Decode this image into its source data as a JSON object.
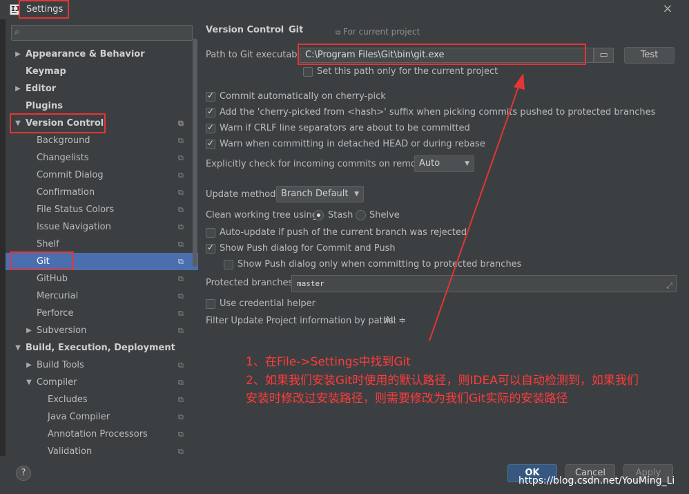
{
  "window": {
    "title": "Settings",
    "app_icon": "IJ",
    "close_icon": "close-icon"
  },
  "sidebar": {
    "search_placeholder": "",
    "search_icon": "search-icon",
    "items": [
      {
        "label": "Appearance & Behavior",
        "level": 0,
        "arrow": "▶",
        "bold": true
      },
      {
        "label": "Keymap",
        "level": 0,
        "arrow": "",
        "bold": true
      },
      {
        "label": "Editor",
        "level": 0,
        "arrow": "▶",
        "bold": true
      },
      {
        "label": "Plugins",
        "level": 0,
        "arrow": "",
        "bold": true
      },
      {
        "label": "Version Control",
        "level": 0,
        "arrow": "▼",
        "bold": true
      },
      {
        "label": "Background",
        "level": 1
      },
      {
        "label": "Changelists",
        "level": 1
      },
      {
        "label": "Commit Dialog",
        "level": 1
      },
      {
        "label": "Confirmation",
        "level": 1
      },
      {
        "label": "File Status Colors",
        "level": 1
      },
      {
        "label": "Issue Navigation",
        "level": 1
      },
      {
        "label": "Shelf",
        "level": 1
      },
      {
        "label": "Git",
        "level": 1,
        "selected": true
      },
      {
        "label": "GitHub",
        "level": 1
      },
      {
        "label": "Mercurial",
        "level": 1
      },
      {
        "label": "Perforce",
        "level": 1
      },
      {
        "label": "Subversion",
        "level": 1,
        "arrow": "▶"
      },
      {
        "label": "Build, Execution, Deployment",
        "level": 0,
        "arrow": "▼",
        "bold": true
      },
      {
        "label": "Build Tools",
        "level": 1,
        "arrow": "▶"
      },
      {
        "label": "Compiler",
        "level": 1,
        "arrow": "▼"
      },
      {
        "label": "Excludes",
        "level": 2
      },
      {
        "label": "Java Compiler",
        "level": 2
      },
      {
        "label": "Annotation Processors",
        "level": 2
      },
      {
        "label": "Validation",
        "level": 2
      }
    ],
    "project_icon": "project-settings-icon"
  },
  "content": {
    "breadcrumb_root": "Version Control",
    "breadcrumb_sep": "›",
    "breadcrumb_leaf": "Git",
    "for_current_project": "For current project",
    "path_label": "Path to Git executable:",
    "path_value": "C:\\Program Files\\Git\\bin\\git.exe",
    "folder_icon": "folder-icon",
    "test_button": "Test",
    "set_path_only": "Set this path only for the current project",
    "commit_cherry_pick": "Commit automatically on cherry-pick",
    "cherry_suffix": "Add the 'cherry-picked from <hash>' suffix when picking commits pushed to protected branches",
    "warn_crlf": "Warn if CRLF line separators are about to be committed",
    "warn_detached": "Warn when committing in detached HEAD or during rebase",
    "incoming_label": "Explicitly check for incoming commits on remotes:",
    "incoming_value": "Auto",
    "update_method_label": "Update method:",
    "update_method_value": "Branch Default",
    "clean_tree_label": "Clean working tree using:",
    "clean_stash": "Stash",
    "clean_shelve": "Shelve",
    "auto_update": "Auto-update if push of the current branch was rejected",
    "show_push": "Show Push dialog for Commit and Push",
    "show_push_protected": "Show Push dialog only when committing to protected branches",
    "protected_label": "Protected branches:",
    "protected_value": "master",
    "credential_helper": "Use credential helper",
    "filter_label": "Filter Update Project information by paths:",
    "filter_value": "All ≑"
  },
  "footer": {
    "help": "?",
    "ok": "OK",
    "cancel": "Cancel",
    "apply": "Apply",
    "watermark": "https://blog.csdn.net/YouMing_Li"
  },
  "annotation": {
    "line1": "1、在File->Settings中找到Git",
    "line2": "2、如果我们安装Git时使用的默认路径，则IDEA可以自动检测到，如果我们",
    "line3": "安装时修改过安装路径，则需要修改为我们Git实际的安装路径",
    "color": "#e53535"
  }
}
